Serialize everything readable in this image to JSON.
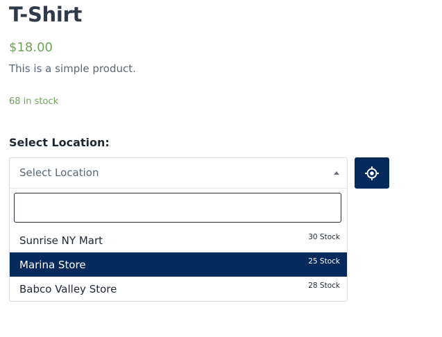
{
  "product": {
    "title": "T-Shirt",
    "price": "$18.00",
    "description": "This is a simple product.",
    "stock": "68 in stock"
  },
  "location": {
    "label": "Select Location:",
    "placeholder": "Select Location",
    "search_value": "",
    "options": [
      {
        "name": "Sunrise NY Mart",
        "stock": "30 Stock",
        "selected": false
      },
      {
        "name": "Marina Store",
        "stock": "25 Stock",
        "selected": true
      },
      {
        "name": "Babco Valley Store",
        "stock": "28 Stock",
        "selected": false
      }
    ],
    "locate_icon": "crosshair-icon"
  },
  "colors": {
    "accent": "#052a5b",
    "price_green": "#6fa35a",
    "text_dark": "#2f3a4a"
  }
}
